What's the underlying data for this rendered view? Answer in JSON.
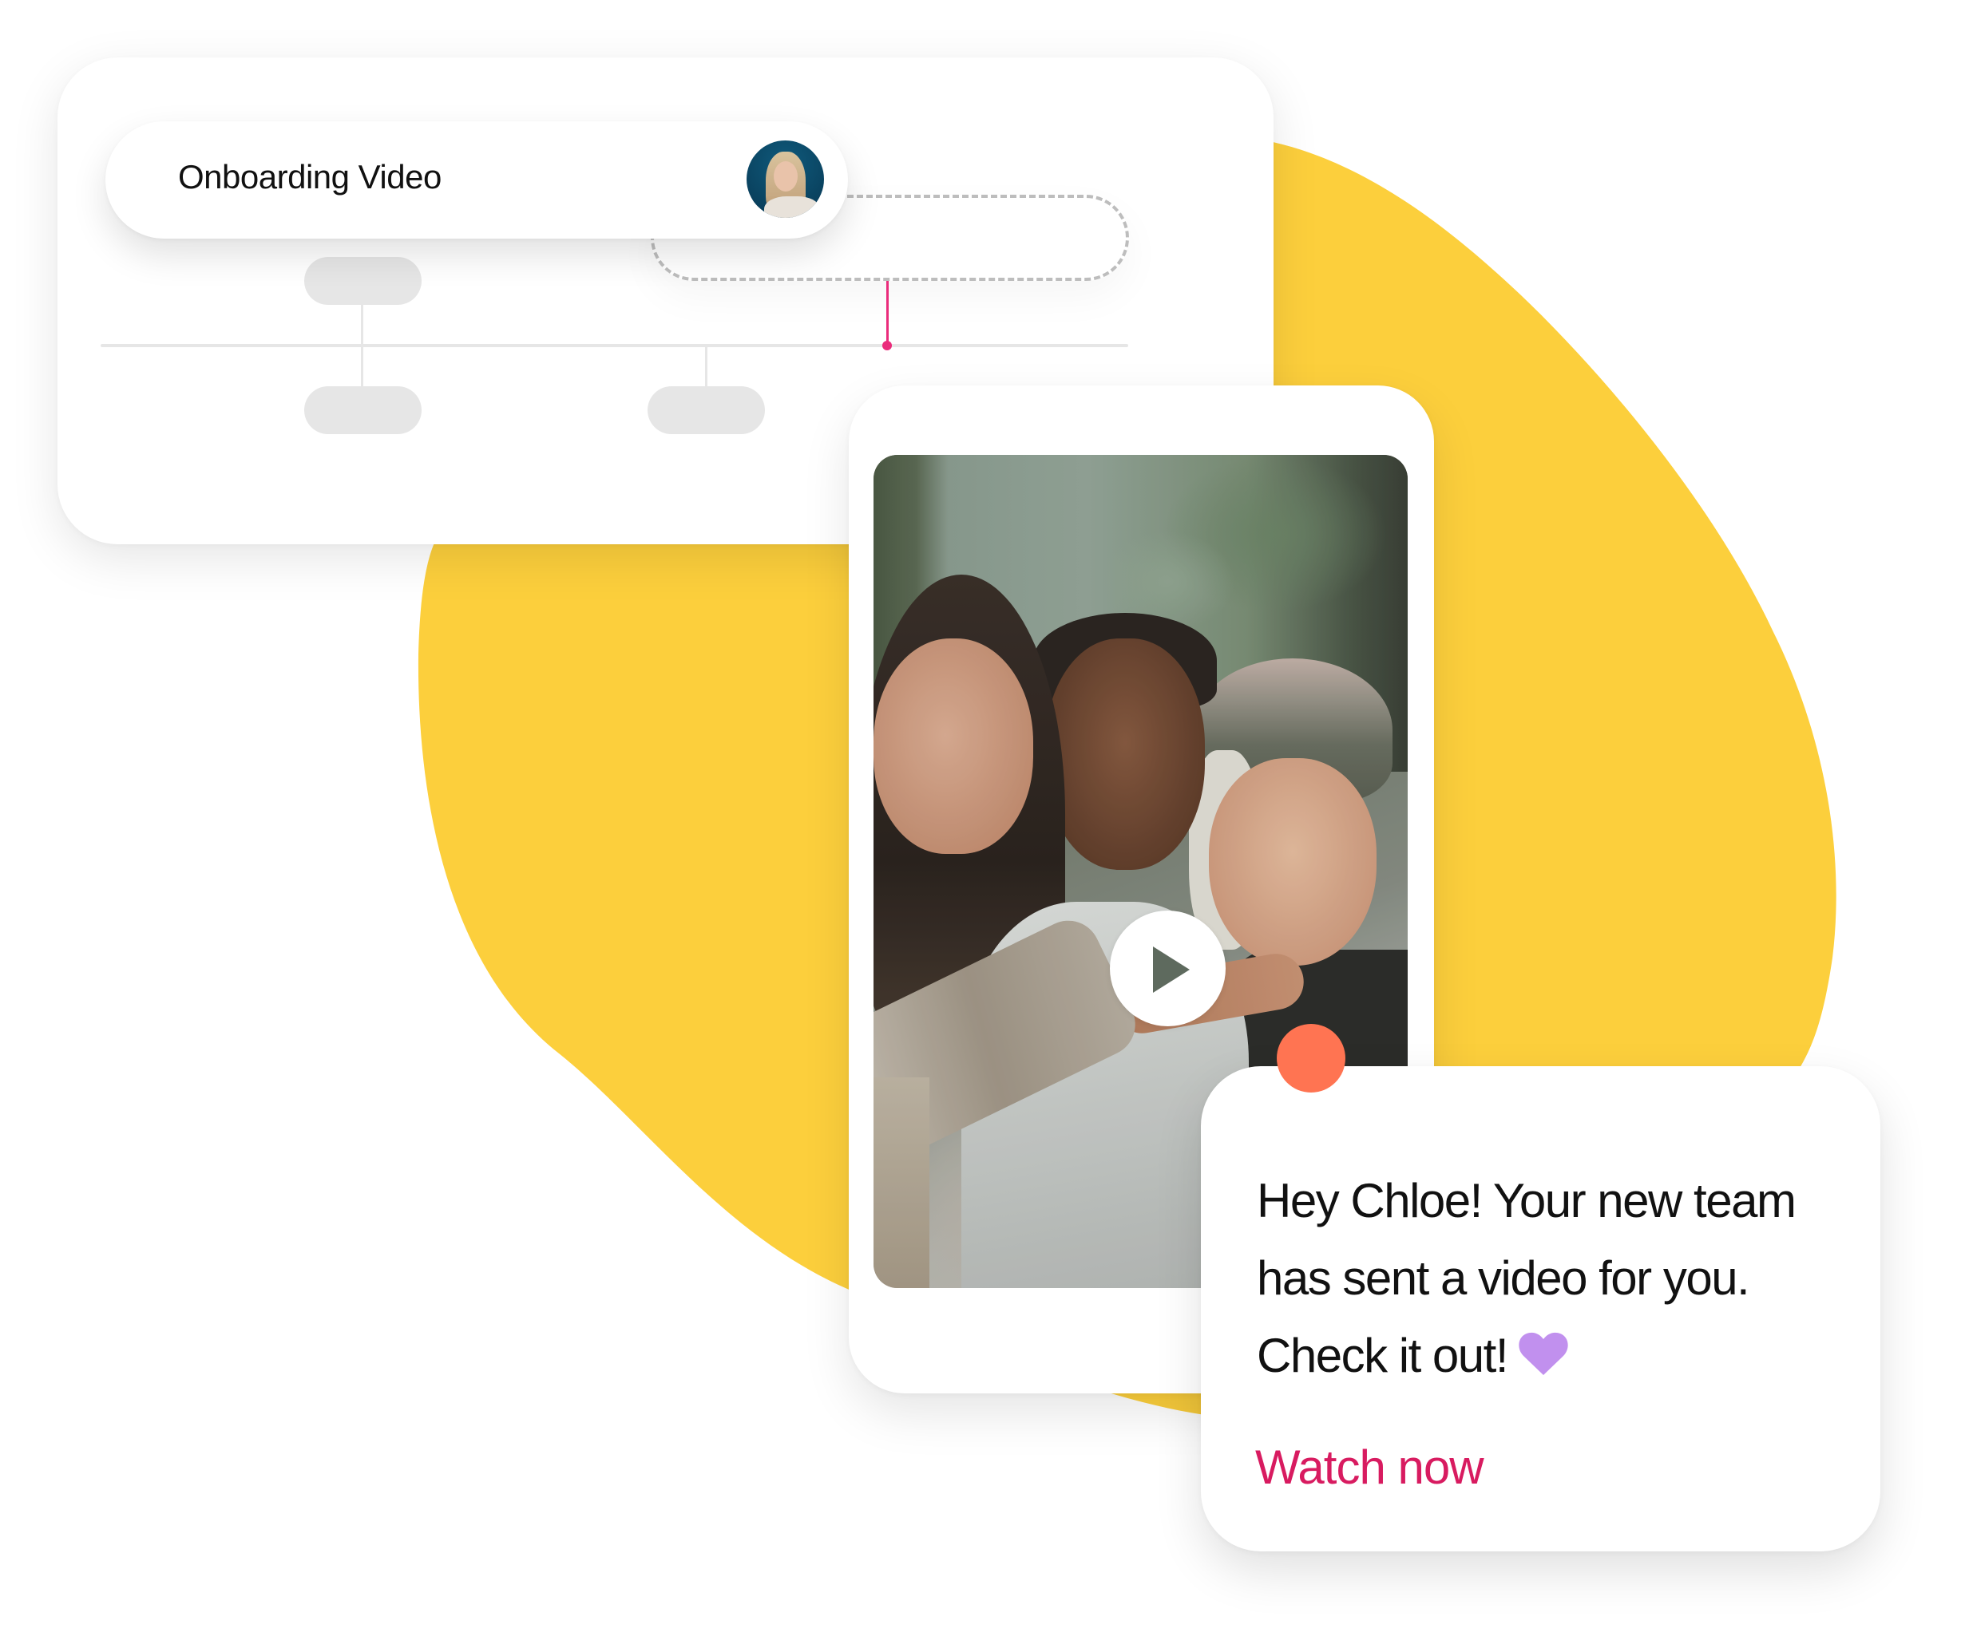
{
  "colors": {
    "blob": "#FCCF3C",
    "accent_pink": "#EA2B7B",
    "link": "#D81B60",
    "notification_dot": "#FF7452",
    "heart": "#C190EE",
    "node_gray": "#E6E6E6",
    "dash_gray": "#BDBDBD"
  },
  "timeline_card": {
    "title": "Onboarding Video",
    "avatar": "user-avatar-photo",
    "nodes_above": 1,
    "nodes_below": 2
  },
  "phone": {
    "video": {
      "description": "Three smiling friends looking at the camera, one pointing",
      "play_icon": "play-icon"
    }
  },
  "notification": {
    "lines": [
      "Hey Chloe! Your new team",
      "has sent a video for you.",
      "Check it out!"
    ],
    "emoji": "heart-icon",
    "cta": "Watch now"
  }
}
